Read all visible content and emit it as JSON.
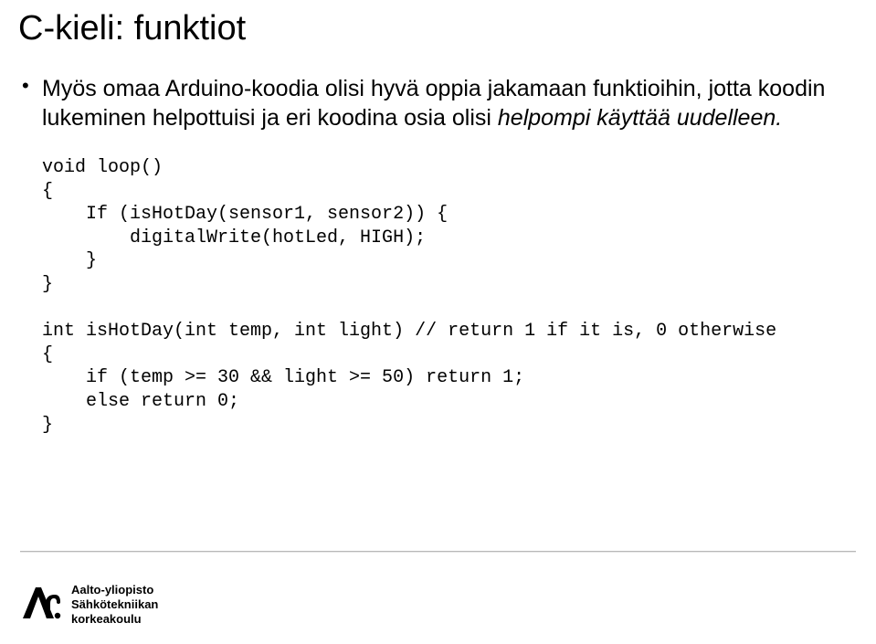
{
  "title": "C-kieli: funktiot",
  "bullet": {
    "part1": "Myös omaa Arduino-koodia olisi hyvä oppia jakamaan funktioihin, jotta koodin lukeminen helpottuisi ja eri koodina osia olisi ",
    "italic": "helpompi käyttää uudelleen.",
    "part2": ""
  },
  "code": "void loop()\n{\n    If (isHotDay(sensor1, sensor2)) {\n        digitalWrite(hotLed, HIGH);\n    }\n}\n\nint isHotDay(int temp, int light) // return 1 if it is, 0 otherwise\n{\n    if (temp >= 30 && light >= 50) return 1;\n    else return 0;\n}",
  "footer": {
    "line1": "Aalto-yliopisto",
    "line2": "Sähkötekniikan",
    "line3": "korkeakoulu"
  }
}
